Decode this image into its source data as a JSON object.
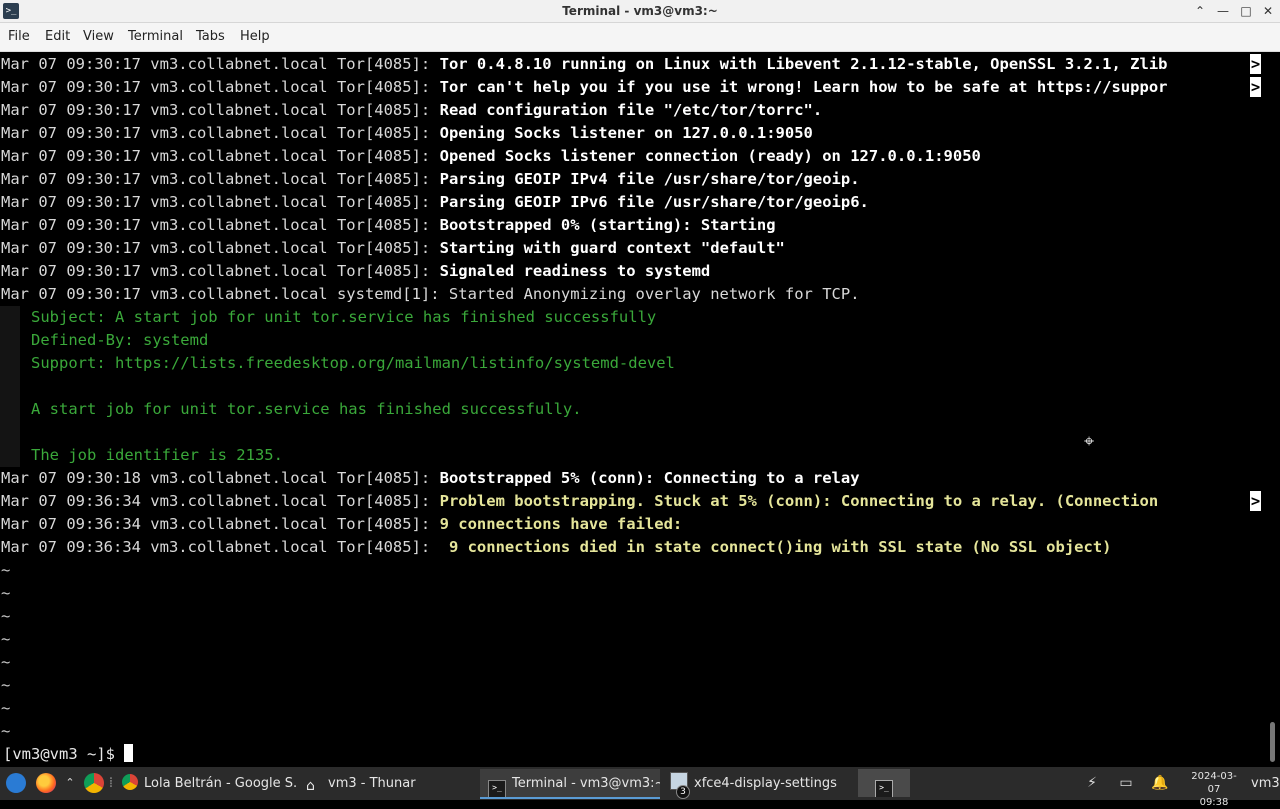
{
  "window": {
    "title": "Terminal - vm3@vm3:~",
    "app_icon": "terminal-icon",
    "controls": [
      "maximize-up-icon",
      "minimize-icon",
      "maximize-icon",
      "close-icon"
    ]
  },
  "menubar": {
    "items": [
      "File",
      "Edit",
      "View",
      "Terminal",
      "Tabs",
      "Help"
    ]
  },
  "terminal": {
    "log_lines": [
      {
        "prefix": "Mar 07 09:30:17 vm3.collabnet.local Tor[4085]: ",
        "message": "Tor 0.4.8.10 running on Linux with Libevent 2.1.12-stable, OpenSSL 3.2.1, Zlib",
        "style": "msg",
        "truncated": true
      },
      {
        "prefix": "Mar 07 09:30:17 vm3.collabnet.local Tor[4085]: ",
        "message": "Tor can't help you if you use it wrong! Learn how to be safe at https://suppor",
        "style": "msg",
        "truncated": true
      },
      {
        "prefix": "Mar 07 09:30:17 vm3.collabnet.local Tor[4085]: ",
        "message": "Read configuration file \"/etc/tor/torrc\".",
        "style": "msg",
        "truncated": false
      },
      {
        "prefix": "Mar 07 09:30:17 vm3.collabnet.local Tor[4085]: ",
        "message": "Opening Socks listener on 127.0.0.1:9050",
        "style": "msg",
        "truncated": false
      },
      {
        "prefix": "Mar 07 09:30:17 vm3.collabnet.local Tor[4085]: ",
        "message": "Opened Socks listener connection (ready) on 127.0.0.1:9050",
        "style": "msg",
        "truncated": false
      },
      {
        "prefix": "Mar 07 09:30:17 vm3.collabnet.local Tor[4085]: ",
        "message": "Parsing GEOIP IPv4 file /usr/share/tor/geoip.",
        "style": "msg",
        "truncated": false
      },
      {
        "prefix": "Mar 07 09:30:17 vm3.collabnet.local Tor[4085]: ",
        "message": "Parsing GEOIP IPv6 file /usr/share/tor/geoip6.",
        "style": "msg",
        "truncated": false
      },
      {
        "prefix": "Mar 07 09:30:17 vm3.collabnet.local Tor[4085]: ",
        "message": "Bootstrapped 0% (starting): Starting",
        "style": "msg",
        "truncated": false
      },
      {
        "prefix": "Mar 07 09:30:17 vm3.collabnet.local Tor[4085]: ",
        "message": "Starting with guard context \"default\"",
        "style": "msg",
        "truncated": false
      },
      {
        "prefix": "Mar 07 09:30:17 vm3.collabnet.local Tor[4085]: ",
        "message": "Signaled readiness to systemd",
        "style": "msg",
        "truncated": false
      },
      {
        "prefix": "Mar 07 09:30:17 vm3.collabnet.local systemd[1]: Started Anonymizing overlay network for TCP.",
        "message": "",
        "style": "plain",
        "truncated": false
      }
    ],
    "catalog_lines": [
      "Subject: A start job for unit tor.service has finished successfully",
      "Defined-By: systemd",
      "Support: https://lists.freedesktop.org/mailman/listinfo/systemd-devel",
      "",
      "A start job for unit tor.service has finished successfully.",
      "",
      "The job identifier is 2135."
    ],
    "log_lines_after": [
      {
        "prefix": "Mar 07 09:30:18 vm3.collabnet.local Tor[4085]: ",
        "message": "Bootstrapped 5% (conn): Connecting to a relay",
        "style": "msg",
        "truncated": false
      },
      {
        "prefix": "Mar 07 09:36:34 vm3.collabnet.local Tor[4085]: ",
        "message": "Problem bootstrapping. Stuck at 5% (conn): Connecting to a relay. (Connection ",
        "style": "warn",
        "truncated": true
      },
      {
        "prefix": "Mar 07 09:36:34 vm3.collabnet.local Tor[4085]: ",
        "message": "9 connections have failed:",
        "style": "warn",
        "truncated": false
      },
      {
        "prefix": "Mar 07 09:36:34 vm3.collabnet.local Tor[4085]: ",
        "message": " 9 connections died in state connect()ing with SSL state (No SSL object)",
        "style": "warn",
        "truncated": false
      }
    ],
    "truncation_marker": ">",
    "tilde_lines": [
      "~",
      "~",
      "~",
      "~",
      "~",
      "~",
      "~",
      "~"
    ],
    "prompt": "[vm3@vm3 ~]$ "
  },
  "taskbar": {
    "launchers": [
      "xfce-menu-icon",
      "firefox-icon",
      "chevron-up-icon",
      "chrome-icon"
    ],
    "separator": "⁞",
    "tasks": [
      {
        "label": "Lola Beltrán - Google S...",
        "icon": "chrome-icon",
        "active": false
      },
      {
        "label": "vm3 - Thunar",
        "icon": "home-folder-icon",
        "active": false
      },
      {
        "label": "Terminal - vm3@vm3:~",
        "icon": "terminal-icon",
        "active": true
      },
      {
        "label": "xfce4-display-settings",
        "icon": "display-settings-icon",
        "active": false,
        "badge": "3"
      }
    ],
    "clock_date": "2024-03-07",
    "clock_time": "09:38",
    "user": "vm3"
  }
}
